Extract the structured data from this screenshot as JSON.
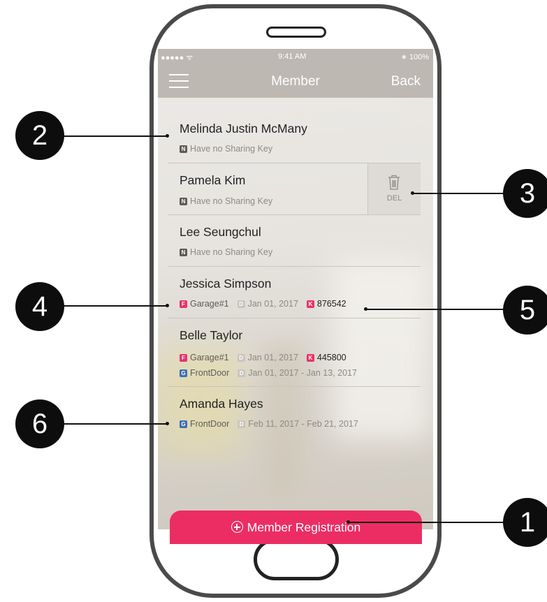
{
  "status_bar": {
    "signal": "●●●●● ᯤ",
    "time": "9:41 AM",
    "battery": "∗ 100%"
  },
  "nav": {
    "title": "Member",
    "back": "Back"
  },
  "members": [
    {
      "name": "Melinda Justin McMany",
      "badge": "N",
      "note": "Have no Sharing Key"
    },
    {
      "name": "Pamela Kim",
      "badge": "N",
      "note": "Have no Sharing Key",
      "delete_label": "DEL"
    },
    {
      "name": "Lee Seungchul",
      "badge": "N",
      "note": "Have no Sharing Key"
    },
    {
      "name": "Jessica Simpson",
      "keys": [
        {
          "type": "F",
          "door": "Garage#1",
          "date": "Jan 01, 2017",
          "code": "876542"
        }
      ]
    },
    {
      "name": "Belle Taylor",
      "keys": [
        {
          "type": "F",
          "door": "Garage#1",
          "date": "Jan 01, 2017",
          "code": "445800"
        },
        {
          "type": "G",
          "door": "FrontDoor",
          "date": "Jan 01, 2017 - Jan 13, 2017"
        }
      ]
    },
    {
      "name": "Amanda Hayes",
      "keys": [
        {
          "type": "G",
          "door": "FrontDoor",
          "date": "Feb 11, 2017 - Feb 21, 2017"
        }
      ]
    }
  ],
  "register_button": "Member Registration",
  "callouts": [
    "1",
    "2",
    "3",
    "4",
    "5",
    "6"
  ],
  "colors": {
    "accent": "#ec2d63",
    "nav_bar": "#bdb8b1",
    "badge_f": "#e8336a",
    "badge_g": "#3f6fb5",
    "badge_n": "#5e5b57"
  },
  "icons": {
    "menu": "hamburger-icon",
    "delete": "trash-icon",
    "register": "plus-circle-icon"
  },
  "badge_letters": {
    "d": "D",
    "k": "K"
  }
}
